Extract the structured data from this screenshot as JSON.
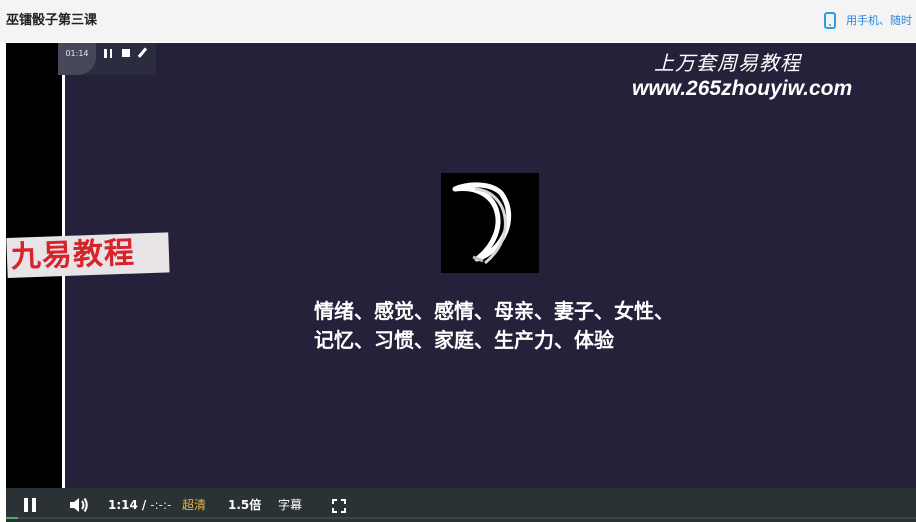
{
  "header": {
    "title": "巫镭骰子第三课",
    "mobile_link": "用手机、随时"
  },
  "video": {
    "watermark_title": "上万套周易教程",
    "watermark_url": "www.265zhouyiw.com",
    "brand_sticker": "九易教程",
    "caption_lines": [
      "情绪、感觉、感情、母亲、妻子、女性、",
      "记忆、习惯、家庭、生产力、体验"
    ],
    "mini_time": "01:14"
  },
  "controls": {
    "current_time": "1:14",
    "separator": "/",
    "duration": "-:-:-",
    "quality": "超清",
    "speed": "1.5倍",
    "subtitle": "字幕",
    "progress": 0.013
  },
  "icons": {
    "mobile": "phone-icon",
    "moon": "crescent-moon-icon",
    "play_pause": "pause-icon",
    "volume": "volume-icon",
    "fullscreen": "fullscreen-icon"
  },
  "colors": {
    "video_bg": "#25213a",
    "control_bar": "#2b3236",
    "progress": "#48b06b",
    "quality": "#e7b53a",
    "link": "#2a83e0",
    "brand": "#d8232a"
  }
}
